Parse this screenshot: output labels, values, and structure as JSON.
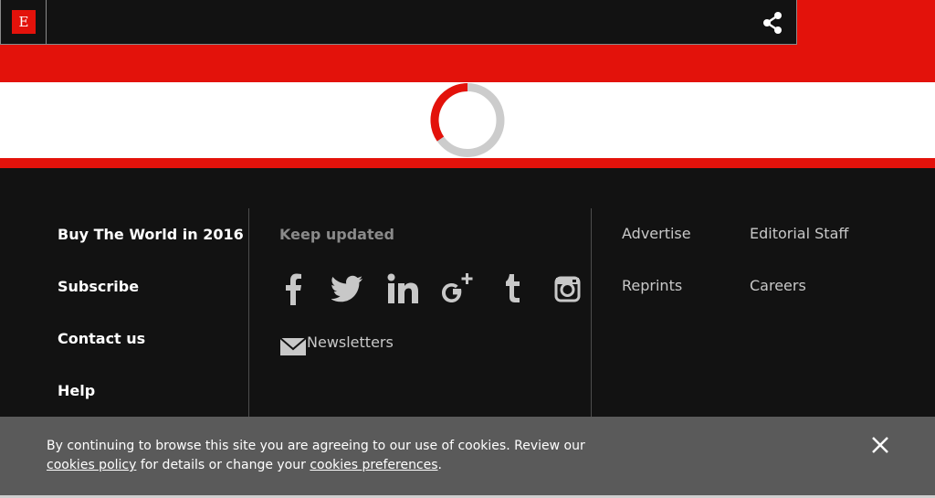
{
  "header": {
    "logo_letter": "E",
    "share_icon": "share-icon"
  },
  "loader": {
    "icon": "loading-spinner",
    "accent_color": "#e3120b",
    "track_color": "#cccccc"
  },
  "footer": {
    "main_links": [
      "Buy The World in 2016",
      "Subscribe",
      "Contact us",
      "Help"
    ],
    "keep_updated": "Keep updated",
    "social_icons": [
      "facebook-icon",
      "twitter-icon",
      "linkedin-icon",
      "google-plus-icon",
      "tumblr-icon",
      "instagram-icon"
    ],
    "newsletter_label": "Newsletters",
    "right_links_col1": [
      "Advertise",
      "Reprints"
    ],
    "right_links_col2": [
      "Editorial Staff",
      "Careers"
    ]
  },
  "cookie_banner": {
    "text_1": "By continuing to browse this site you are agreeing to our use of cookies. Review our",
    "link_1": "cookies policy",
    "text_2": "for details or change your",
    "link_2": "cookies preferences",
    "text_3": ".",
    "close_icon": "close-icon"
  },
  "colors": {
    "brand_red": "#e3120b",
    "footer_bg": "#121212",
    "banner_bg": "#5a5a5a"
  }
}
